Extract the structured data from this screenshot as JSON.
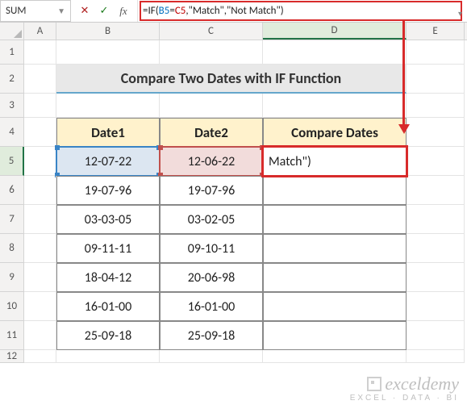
{
  "nameBox": "SUM",
  "formulaBar": {
    "prefix": "=IF(",
    "refB": "B5",
    "eq": "=",
    "refC": "C5",
    "suffix": ",\"Match\",\"Not Match\")"
  },
  "columns": [
    "A",
    "B",
    "C",
    "D",
    "E"
  ],
  "rowLabels": [
    "1",
    "2",
    "3",
    "4",
    "5",
    "6",
    "7",
    "8",
    "9",
    "10",
    "11",
    "12"
  ],
  "title": "Compare Two Dates with IF Function",
  "headers": {
    "b": "Date1",
    "c": "Date2",
    "d": "Compare Dates"
  },
  "activeCellDisplay": "Match\")",
  "rows": [
    {
      "b": "12-07-22",
      "c": "12-06-22"
    },
    {
      "b": "19-07-96",
      "c": "19-07-96"
    },
    {
      "b": "03-03-05",
      "c": "03-02-05"
    },
    {
      "b": "09-11-11",
      "c": "09-10-11"
    },
    {
      "b": "18-04-12",
      "c": "20-06-98"
    },
    {
      "b": "16-01-00",
      "c": "16-01-00"
    },
    {
      "b": "25-09-18",
      "c": "25-09-18"
    }
  ],
  "watermark": {
    "line1": "exceldemy",
    "line2": "EXCEL · DATA · BI"
  }
}
